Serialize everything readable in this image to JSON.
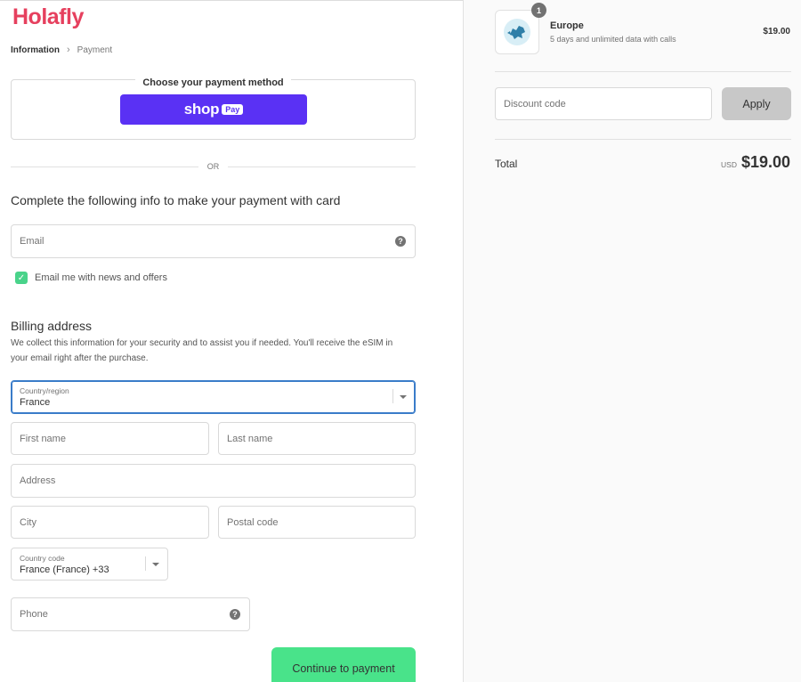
{
  "brand": {
    "name": "Holafly",
    "color": "#e6405e"
  },
  "breadcrumb": {
    "items": [
      "Information",
      "Payment"
    ],
    "separator": "›"
  },
  "express": {
    "legend": "Choose your payment method",
    "shop_label": "shop",
    "shop_pay_badge": "Pay",
    "shop_color": "#5a31f4"
  },
  "divider": {
    "or_label": "OR"
  },
  "card_section": {
    "heading": "Complete the following info to make your payment with card"
  },
  "email": {
    "placeholder": "Email",
    "help_icon": "?"
  },
  "newsletter": {
    "label": "Email me with news and offers",
    "checked": true,
    "check_glyph": "✓"
  },
  "billing": {
    "title": "Billing address",
    "description": "We collect this information for your security and to assist you if needed. You'll receive the eSIM in your email right after the purchase.",
    "country": {
      "label": "Country/region",
      "value": "France"
    },
    "first_name": {
      "placeholder": "First name"
    },
    "last_name": {
      "placeholder": "Last name"
    },
    "address": {
      "placeholder": "Address"
    },
    "city": {
      "placeholder": "City"
    },
    "postal_code": {
      "placeholder": "Postal code"
    },
    "country_code": {
      "label": "Country code",
      "value": "France (France) +33"
    },
    "phone": {
      "placeholder": "Phone",
      "help_icon": "?"
    }
  },
  "continue_button": {
    "label": "Continue to payment",
    "color": "#49e38a"
  },
  "order": {
    "item": {
      "quantity": "1",
      "name": "Europe",
      "description": "5 days and unlimited data with calls",
      "price": "$19.00"
    },
    "discount": {
      "placeholder": "Discount code",
      "apply_label": "Apply"
    },
    "total": {
      "label": "Total",
      "currency": "USD",
      "amount": "$19.00"
    }
  }
}
